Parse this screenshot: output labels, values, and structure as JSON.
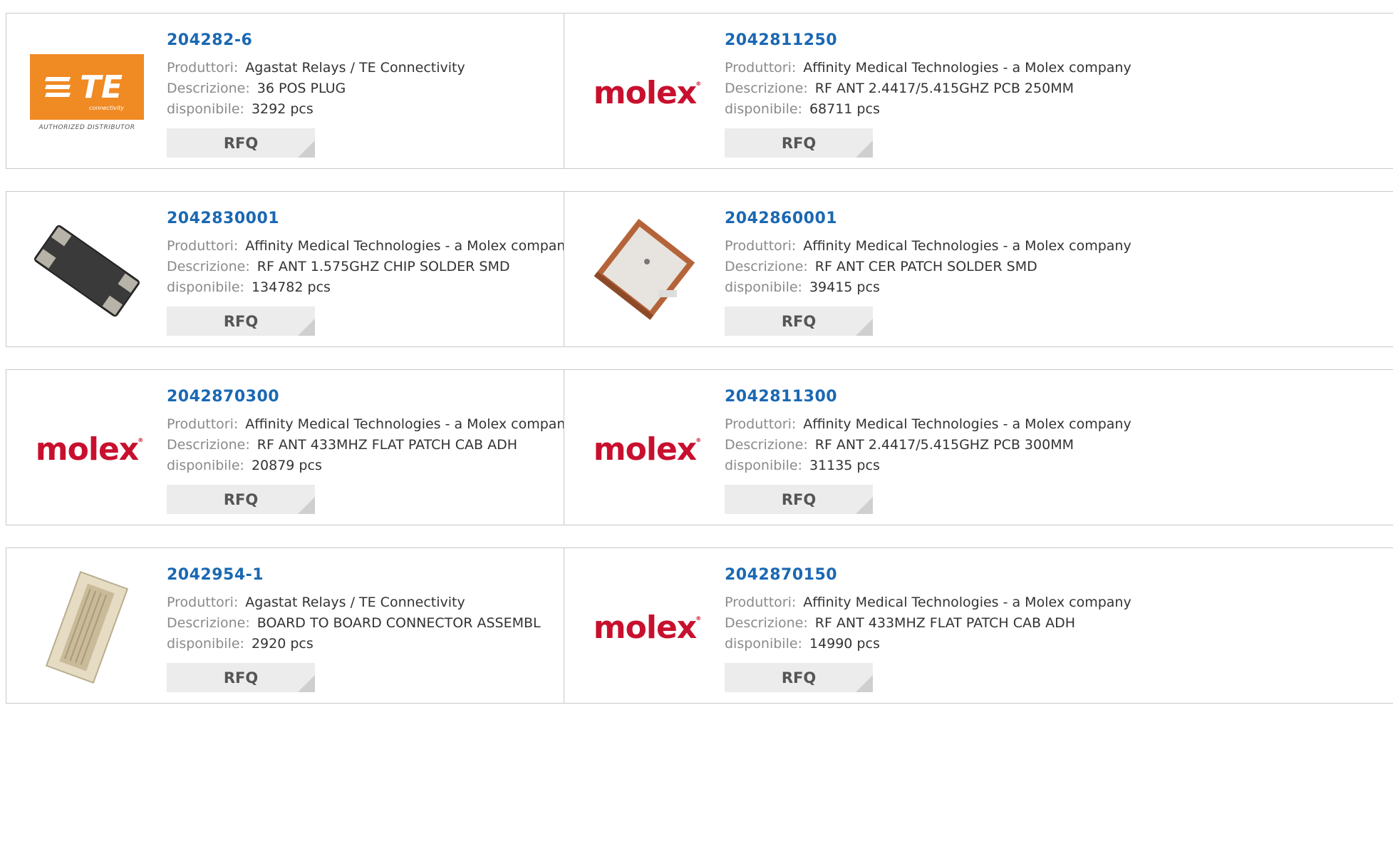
{
  "labels": {
    "manufacturer": "Produttori:",
    "description": "Descrizione:",
    "available": "disponibile:",
    "rfq": "RFQ"
  },
  "te_logo": {
    "mark": "TE",
    "sub": "connectivity",
    "authorized": "AUTHORIZED DISTRIBUTOR"
  },
  "molex_logo": {
    "text": "molex",
    "mark": "®"
  },
  "products": [
    {
      "part": "204282-6",
      "manufacturer": "Agastat Relays / TE Connectivity",
      "description": "36 POS PLUG",
      "available": "3292 pcs",
      "image": "te-logo"
    },
    {
      "part": "2042811250",
      "manufacturer": "Affinity Medical Technologies - a Molex company",
      "description": "RF ANT 2.4417/5.415GHZ PCB 250MM",
      "available": "68711 pcs",
      "image": "molex-logo"
    },
    {
      "part": "2042830001",
      "manufacturer": "Affinity Medical Technologies - a Molex company",
      "description": "RF ANT 1.575GHZ CHIP SOLDER SMD",
      "available": "134782 pcs",
      "image": "chip-antenna"
    },
    {
      "part": "2042860001",
      "manufacturer": "Affinity Medical Technologies - a Molex company",
      "description": "RF ANT CER PATCH SOLDER SMD",
      "available": "39415 pcs",
      "image": "patch-antenna"
    },
    {
      "part": "2042870300",
      "manufacturer": "Affinity Medical Technologies - a Molex company",
      "description": "RF ANT 433MHZ FLAT PATCH CAB ADH",
      "available": "20879 pcs",
      "image": "molex-logo"
    },
    {
      "part": "2042811300",
      "manufacturer": "Affinity Medical Technologies - a Molex company",
      "description": "RF ANT 2.4417/5.415GHZ PCB 300MM",
      "available": "31135 pcs",
      "image": "molex-logo"
    },
    {
      "part": "2042954-1",
      "manufacturer": "Agastat Relays / TE Connectivity",
      "description": "BOARD TO BOARD CONNECTOR ASSEMBL",
      "available": "2920 pcs",
      "image": "connector"
    },
    {
      "part": "2042870150",
      "manufacturer": "Affinity Medical Technologies - a Molex company",
      "description": "RF ANT 433MHZ FLAT PATCH CAB ADH",
      "available": "14990 pcs",
      "image": "molex-logo"
    }
  ]
}
